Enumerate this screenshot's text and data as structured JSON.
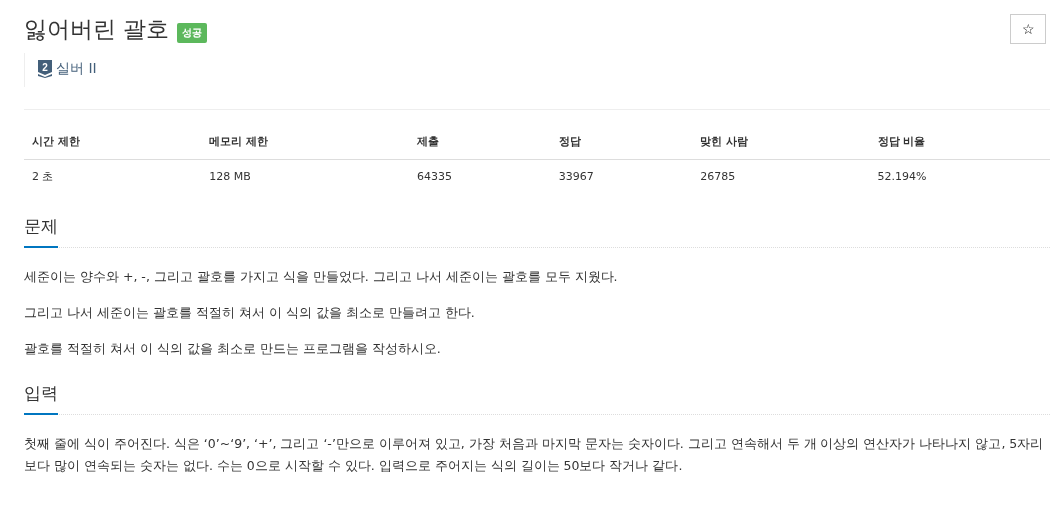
{
  "title": "잃어버린 괄호",
  "result_badge": "성공",
  "favorite_button": "☆",
  "tier": {
    "number": "2",
    "label": "실버 II"
  },
  "stats_table": {
    "columns": [
      "시간 제한",
      "메모리 제한",
      "제출",
      "정답",
      "맞힌 사람",
      "정답 비율"
    ],
    "rows": [
      [
        "2 초",
        "128 MB",
        "64335",
        "33967",
        "26785",
        "52.194%"
      ]
    ]
  },
  "sections": [
    {
      "heading": "문제",
      "paragraphs": [
        "세준이는 양수와 +, -, 그리고 괄호를 가지고 식을 만들었다. 그리고 나서 세준이는 괄호를 모두 지웠다.",
        "그리고 나서 세준이는 괄호를 적절히 쳐서 이 식의 값을 최소로 만들려고 한다.",
        "괄호를 적절히 쳐서 이 식의 값을 최소로 만드는 프로그램을 작성하시오."
      ]
    },
    {
      "heading": "입력",
      "paragraphs": [
        "첫째 줄에 식이 주어진다. 식은 ‘0’~‘9’, ‘+’, 그리고 ‘-’만으로 이루어져 있고, 가장 처음과 마지막 문자는 숫자이다. 그리고 연속해서 두 개 이상의 연산자가 나타나지 않고, 5자리보다 많이 연속되는 숫자는 없다. 수는 0으로 시작할 수 있다. 입력으로 주어지는 식의 길이는 50보다 작거나 같다."
      ]
    }
  ]
}
